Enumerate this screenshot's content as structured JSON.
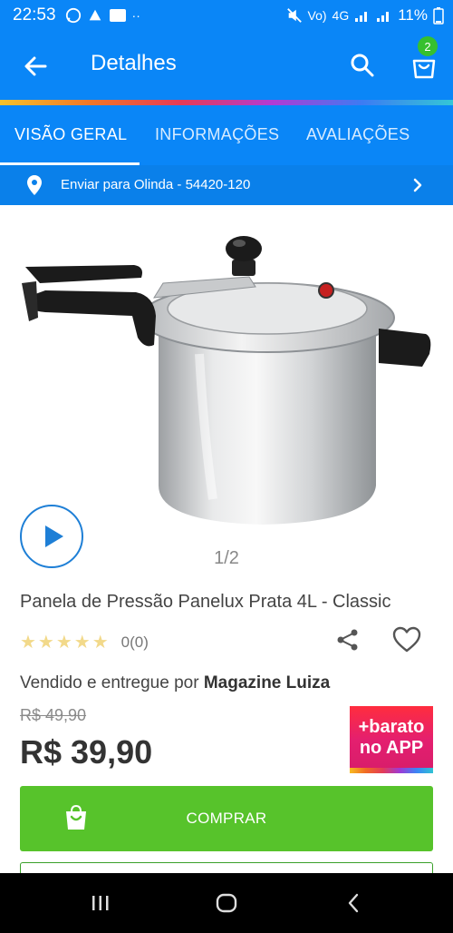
{
  "status_bar": {
    "time": "22:53",
    "battery": "11%",
    "network": "4G"
  },
  "app_bar": {
    "title": "Detalhes",
    "cart_count": "2"
  },
  "tabs": [
    {
      "label": "VISÃO GERAL",
      "active": true
    },
    {
      "label": "INFORMAÇÕES",
      "active": false
    },
    {
      "label": "AVALIAÇÕES",
      "active": false
    }
  ],
  "shipping": {
    "label": "Enviar para Olinda - 54420-120"
  },
  "gallery": {
    "pager": "1/2"
  },
  "product": {
    "name": "Panela de Pressão Panelux Prata 4L - Classic",
    "stars": "★★★★★",
    "rating_count": "0(0)",
    "seller_prefix": "Vendido e entregue por ",
    "seller_name": "Magazine Luiza",
    "old_price": "R$ 49,90",
    "price": "R$ 39,90"
  },
  "promo": {
    "line1": "+barato",
    "line2": "no APP"
  },
  "buy_button": {
    "label": "COMPRAR"
  },
  "colors": {
    "primary": "#0a86f7",
    "buy_green": "#57c32b",
    "badge_green": "#36c02e"
  }
}
